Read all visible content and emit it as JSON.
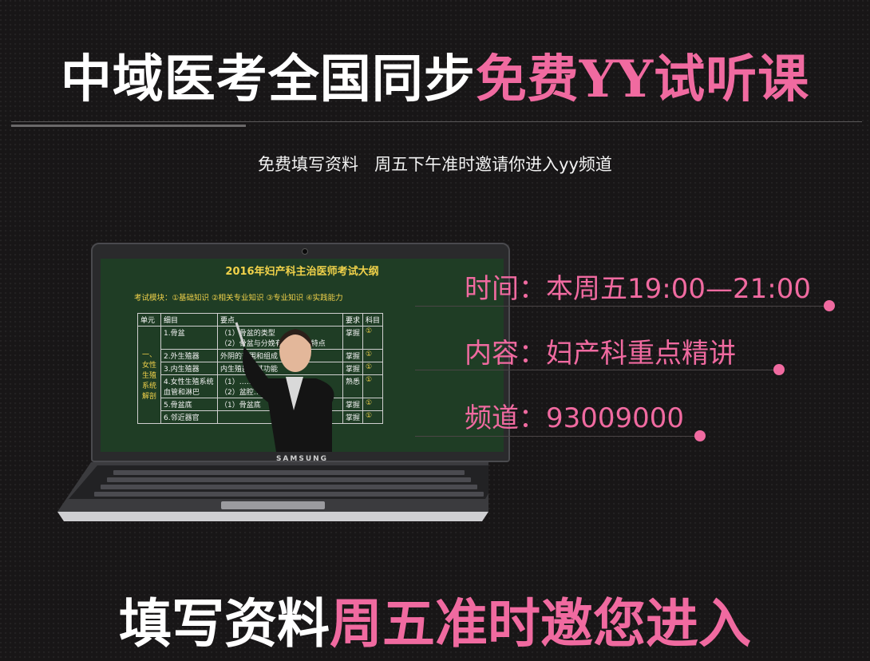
{
  "header": {
    "title_white": "中域医考全国同步",
    "title_pink": "免费YY试听课",
    "subtitle": "免费填写资料   周五下午准时邀请你进入yy频道"
  },
  "laptop": {
    "brand": "SAMSUNG",
    "slide": {
      "title": "2016年妇产科主治医师考试大纲",
      "modules": "考试模块：①基础知识  ②相关专业知识  ③专业知识  ④实践能力",
      "headers": [
        "单元",
        "细目",
        "要点",
        "要求",
        "科目"
      ],
      "unit": "一、女性生殖系统解剖",
      "rows": [
        {
          "item": "1.骨盆",
          "points": "（1）骨盆的类型\n（2）骨盆与分娩有关的解剖特点",
          "req": "掌握",
          "subj": "①"
        },
        {
          "item": "2.外生殖器",
          "points": "外阴的范围和组成",
          "req": "掌握",
          "subj": "①"
        },
        {
          "item": "3.内生殖器",
          "points": "内生殖器及其功能",
          "req": "掌握",
          "subj": "①"
        },
        {
          "item": "4.女性生殖系统血管和淋巴",
          "points": "（1）……\n（2）盆腔……巴管的流经方向",
          "req": "熟悉",
          "subj": "①"
        },
        {
          "item": "5.骨盆底",
          "points": "（1）骨盆底",
          "req": "掌握",
          "subj": "①"
        },
        {
          "item": "6.邻近器官",
          "points": "",
          "req": "掌握",
          "subj": "①"
        }
      ]
    }
  },
  "info": {
    "time": "时间：本周五19:00—21:00",
    "content": "内容：妇产科重点精讲",
    "channel": "频道：93009000"
  },
  "cta": {
    "white": "填写资料",
    "pink": "周五准时邀您进入"
  },
  "colors": {
    "accent_pink": "#f06aa0",
    "background": "#181617",
    "board_green": "#1f3d25",
    "board_yellow": "#f1d24a"
  }
}
